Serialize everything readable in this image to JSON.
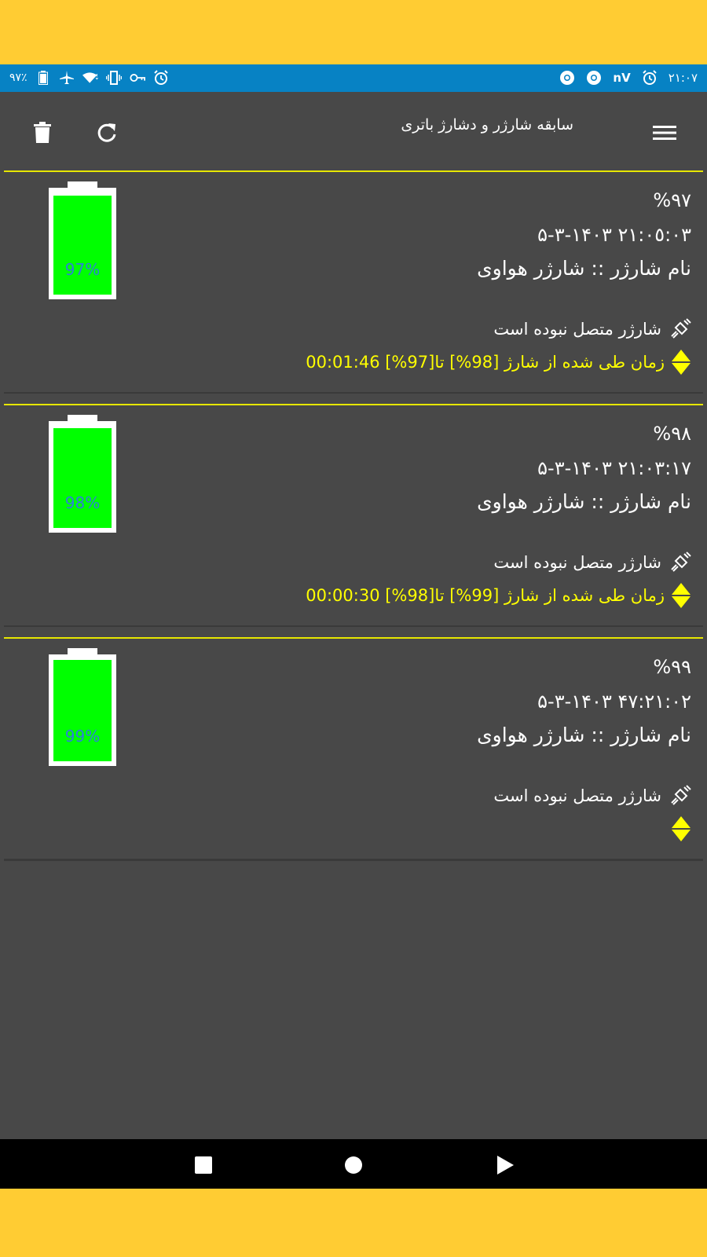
{
  "status_bar": {
    "battery_percent": "٩٧٪",
    "time": "٢١:٠٧",
    "carrier_label": "nV",
    "bg_color": "#0782C4"
  },
  "toolbar": {
    "title": "سابقه شارژر و دشارژ باتری",
    "menu_icon": "hamburger-menu-icon",
    "refresh_icon": "refresh-icon",
    "delete_icon": "trash-icon"
  },
  "records": [
    {
      "percent": "٩٧%",
      "datetime": "٢١:٠٥:٠٣ ١۴٠٣-٣-۵",
      "charger_name": "نام شارژر :: شارژر هواوی",
      "connection": "شارژر متصل نبوده است",
      "elapsed": "زمان طی شده از شارژ [98%] تا[97%] 00:01:46",
      "battery_label": "97%",
      "battery_level": 0.97
    },
    {
      "percent": "٩٨%",
      "datetime": "٢١:٠٣:١٧ ١۴٠٣-٣-۵",
      "charger_name": "نام شارژر :: شارژر هواوی",
      "connection": "شارژر متصل نبوده است",
      "elapsed": "زمان طی شده از شارژ [99%] تا[98%] 00:00:30",
      "battery_label": "98%",
      "battery_level": 0.98
    },
    {
      "percent": "٩٩%",
      "datetime": "٢١:٠٢:۴٧ ١۴٠٣-٣-۵",
      "charger_name": "نام شارژر :: شارژر هواوی",
      "connection": "شارژر متصل نبوده است",
      "elapsed": "",
      "battery_label": "99%",
      "battery_level": 0.99
    }
  ],
  "colors": {
    "frame": "#FFCC33",
    "background": "#484848",
    "divider": "#E6E600",
    "battery_fill": "#00FF00",
    "battery_text": "#2E7FD8",
    "elapsed_text": "#FFFF00"
  },
  "navigation": {
    "recents_icon": "square-recents-icon",
    "home_icon": "circle-home-icon",
    "back_icon": "triangle-back-icon"
  }
}
